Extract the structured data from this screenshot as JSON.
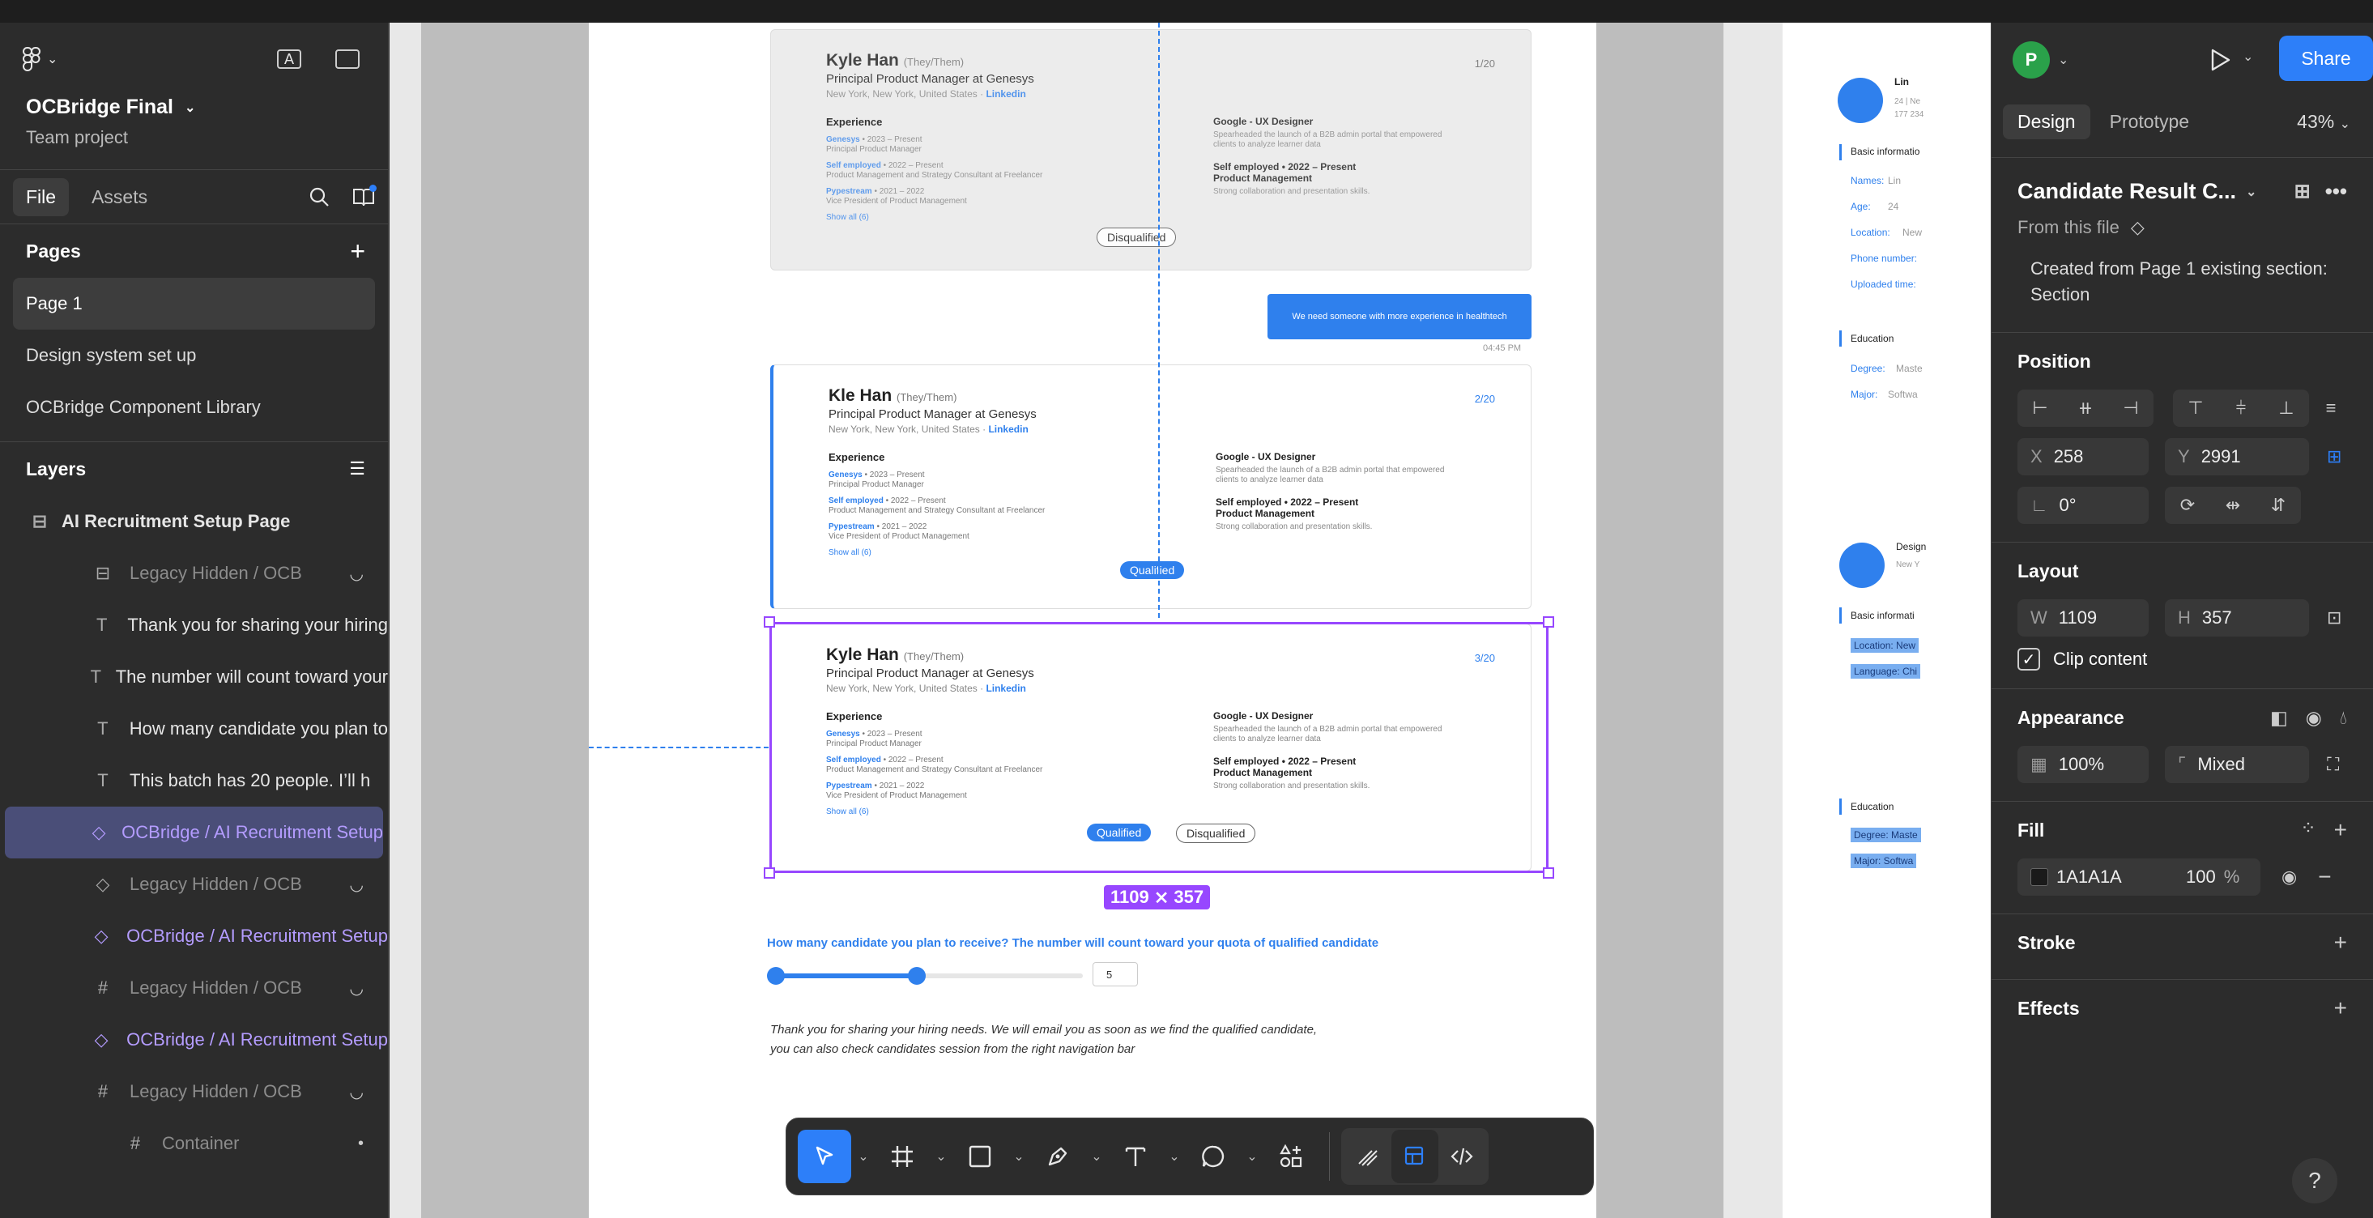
{
  "file": {
    "title": "OCBridge Final",
    "subtitle": "Team project"
  },
  "left_tabs": [
    "File",
    "Assets"
  ],
  "pages": {
    "heading": "Pages",
    "items": [
      "Page 1",
      "Design system set up",
      "OCBridge Component Library"
    ]
  },
  "layers": {
    "heading": "Layers",
    "root": "AI Recruitment Setup Page",
    "items": [
      {
        "label": "Legacy Hidden / OCB",
        "icon": "component-frame-icon",
        "kind": "dim"
      },
      {
        "label": "Thank you for sharing your hiring",
        "icon": "text-icon",
        "kind": "normal"
      },
      {
        "label": "The number will count toward your",
        "icon": "text-icon",
        "kind": "normal"
      },
      {
        "label": "How many candidate you plan to",
        "icon": "text-icon",
        "kind": "normal"
      },
      {
        "label": "This batch has 20 people. I’ll h",
        "icon": "text-icon",
        "kind": "normal"
      },
      {
        "label": "OCBridge / AI Recruitment Setup",
        "icon": "instance-icon",
        "kind": "selected"
      },
      {
        "label": "Legacy Hidden / OCB",
        "icon": "instance-icon",
        "kind": "dim"
      },
      {
        "label": "OCBridge / AI Recruitment Setup",
        "icon": "instance-icon",
        "kind": "purple"
      },
      {
        "label": "Legacy Hidden / OCB",
        "icon": "frame-icon",
        "kind": "dim"
      },
      {
        "label": "OCBridge / AI Recruitment Setup",
        "icon": "instance-icon",
        "kind": "purple"
      },
      {
        "label": "Legacy Hidden / OCB",
        "icon": "frame-icon",
        "kind": "dim"
      },
      {
        "label": "Container",
        "icon": "frame-icon",
        "kind": "dim-child"
      }
    ]
  },
  "canvas": {
    "candidates": [
      {
        "name": "Kyle Han",
        "pronoun": "(They/Them)",
        "role": "Principal Product Manager at Genesys",
        "location": "New York, New York, United States · ",
        "link": "Linkedin",
        "count": "1/20",
        "exp_heading": "Experience",
        "exp": [
          [
            "Genesys",
            " • 2023 – Present",
            "Principal Product Manager"
          ],
          [
            "Self employed",
            " • 2022 – Present",
            "Product Management and Strategy Consultant at Freelancer"
          ],
          [
            "Pypestream",
            " • 2021 – 2022",
            "Vice President of Product Management"
          ]
        ],
        "show_all": "Show all (6)",
        "right1_title": "Google - UX Designer",
        "right1_desc": "Spearheaded the launch of a B2B admin portal that empowered clients to analyze learner data",
        "right2_title": "Self employed • 2022 – Present Product Management",
        "right2_desc": "Strong collaboration and presentation skills.",
        "pills": [
          "Disqualified"
        ]
      },
      {
        "name": "Kle Han",
        "pronoun": "(They/Them)",
        "role": "Principal Product Manager at Genesys",
        "location": "New York, New York, United States · ",
        "link": "Linkedin",
        "count": "2/20",
        "exp_heading": "Experience",
        "exp": [
          [
            "Genesys",
            " • 2023 – Present",
            "Principal Product Manager"
          ],
          [
            "Self employed",
            " • 2022 – Present",
            "Product Management and Strategy Consultant at Freelancer"
          ],
          [
            "Pypestream",
            " • 2021 – 2022",
            "Vice President of Product Management"
          ]
        ],
        "show_all": "Show all (6)",
        "right1_title": "Google - UX Designer",
        "right1_desc": "Spearheaded the launch of a B2B admin portal that empowered clients to analyze learner data",
        "right2_title": "Self employed • 2022 – Present Product Management",
        "right2_desc": "Strong collaboration and presentation skills.",
        "pills": [
          "Qualified"
        ]
      },
      {
        "name": "Kyle Han",
        "pronoun": "(They/Them)",
        "role": "Principal Product Manager at Genesys",
        "location": "New York, New York, United States · ",
        "link": "Linkedin",
        "count": "3/20",
        "exp_heading": "Experience",
        "exp": [
          [
            "Genesys",
            " • 2023 – Present",
            "Principal Product Manager"
          ],
          [
            "Self employed",
            " • 2022 – Present",
            "Product Management and Strategy Consultant at Freelancer"
          ],
          [
            "Pypestream",
            " • 2021 – 2022",
            "Vice President of Product Management"
          ]
        ],
        "show_all": "Show all (6)",
        "right1_title": "Google - UX Designer",
        "right1_desc": "Spearheaded the launch of a B2B admin portal that empowered clients to analyze learner data",
        "right2_title": "Self employed • 2022 – Present Product Management",
        "right2_desc": "Strong collaboration and presentation skills.",
        "pills": [
          "Qualified",
          "Disqualified"
        ]
      }
    ],
    "chat_message": "We need someone with more experience in healthtech",
    "chat_time": "04:45 PM",
    "dimension_label": "1109 ⨯ 357",
    "question": "How many candidate you plan to receive?   The number will count toward your quota of qualified candidate",
    "slider_value_fraction": 0.46,
    "stepper_value": "5",
    "thanks_line1": "Thank you for sharing your hiring needs. We will email you as soon as we find the qualified candidate,",
    "thanks_line2": "you can also check candidates session from the right navigation bar",
    "side_frame": {
      "name1": "Lin",
      "name1_sub": "24 | Ne",
      "name1_sub2": "177 234",
      "basic_info": "Basic informatio",
      "fields": [
        "Names:",
        "Age:",
        "Location:",
        "Phone number:",
        "Uploaded time:"
      ],
      "values": [
        "Lin",
        "24",
        "New",
        "",
        ""
      ],
      "education": "Education",
      "degree": "Degree:",
      "degree_val": "Maste",
      "major": "Major:",
      "major_val": "Softwa",
      "name2": "Design",
      "name2_sub": "New Y",
      "basic_info2": "Basic informati",
      "hl1": "Location:  New",
      "hl2": "Language:  Chi",
      "education2": "Education",
      "hl3": "Degree:    Maste",
      "hl4": "Major:     Softwa"
    }
  },
  "right_panel": {
    "avatar_letter": "P",
    "share_label": "Share",
    "tabs": [
      "Design",
      "Prototype"
    ],
    "zoom": "43%",
    "component_name": "Candidate Result C...",
    "source": "From this file",
    "description": "Created from Page 1 existing section: Section",
    "position_heading": "Position",
    "x_label": "X",
    "x_value": "258",
    "y_label": "Y",
    "y_value": "2991",
    "rotation": "0°",
    "layout_heading": "Layout",
    "w_label": "W",
    "w_value": "1109",
    "h_label": "H",
    "h_value": "357",
    "clip_label": "Clip content",
    "appearance_heading": "Appearance",
    "opacity": "100%",
    "radius": "Mixed",
    "fill_heading": "Fill",
    "fill_hex": "1A1A1A",
    "fill_opacity": "100",
    "fill_pct": "%",
    "stroke_heading": "Stroke",
    "effects_heading": "Effects",
    "help": "?"
  },
  "colors": {
    "accent": "#2d7ff9",
    "selection": "#9747ff",
    "fill": "#1A1A1A"
  }
}
